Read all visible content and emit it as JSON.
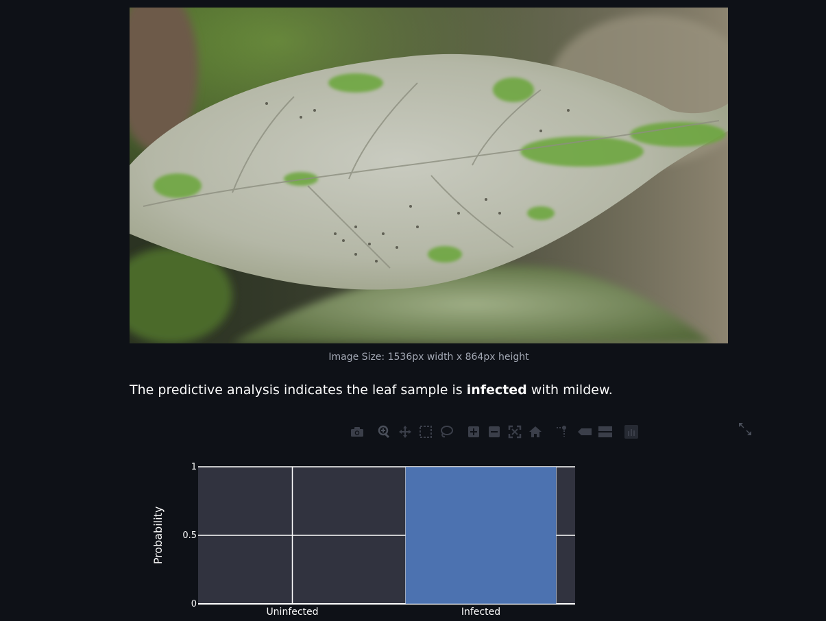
{
  "image": {
    "caption": "Image Size: 1536px width x 864px height",
    "subject": "mildew-infected leaf photo"
  },
  "result": {
    "prefix": "The predictive analysis indicates the leaf sample is ",
    "emphasis": "infected",
    "suffix": " with mildew."
  },
  "modebar": {
    "buttons": [
      {
        "name": "camera-icon"
      },
      {
        "name": "zoom-icon"
      },
      {
        "name": "pan-icon"
      },
      {
        "name": "box-select-icon"
      },
      {
        "name": "lasso-select-icon"
      },
      {
        "name": "zoom-in-icon"
      },
      {
        "name": "zoom-out-icon"
      },
      {
        "name": "autoscale-icon"
      },
      {
        "name": "reset-axes-icon"
      },
      {
        "name": "spike-lines-icon"
      },
      {
        "name": "hover-closest-icon"
      },
      {
        "name": "hover-compare-icon"
      },
      {
        "name": "plotly-logo-icon"
      }
    ],
    "fullscreen": {
      "name": "expand-icon"
    }
  },
  "colors": {
    "background": "#0e1117",
    "plot_bg": "#31333f",
    "bar": "#4c72b0",
    "grid": "#ffffff",
    "text": "#fafafa"
  },
  "chart_data": {
    "type": "bar",
    "categories": [
      "Uninfected",
      "Infected"
    ],
    "values": [
      0,
      1
    ],
    "ylabel": "Probability",
    "xlabel": "",
    "ylim": [
      0,
      1
    ],
    "yticks": [
      "0",
      "0.5",
      "1"
    ],
    "grid": true
  }
}
